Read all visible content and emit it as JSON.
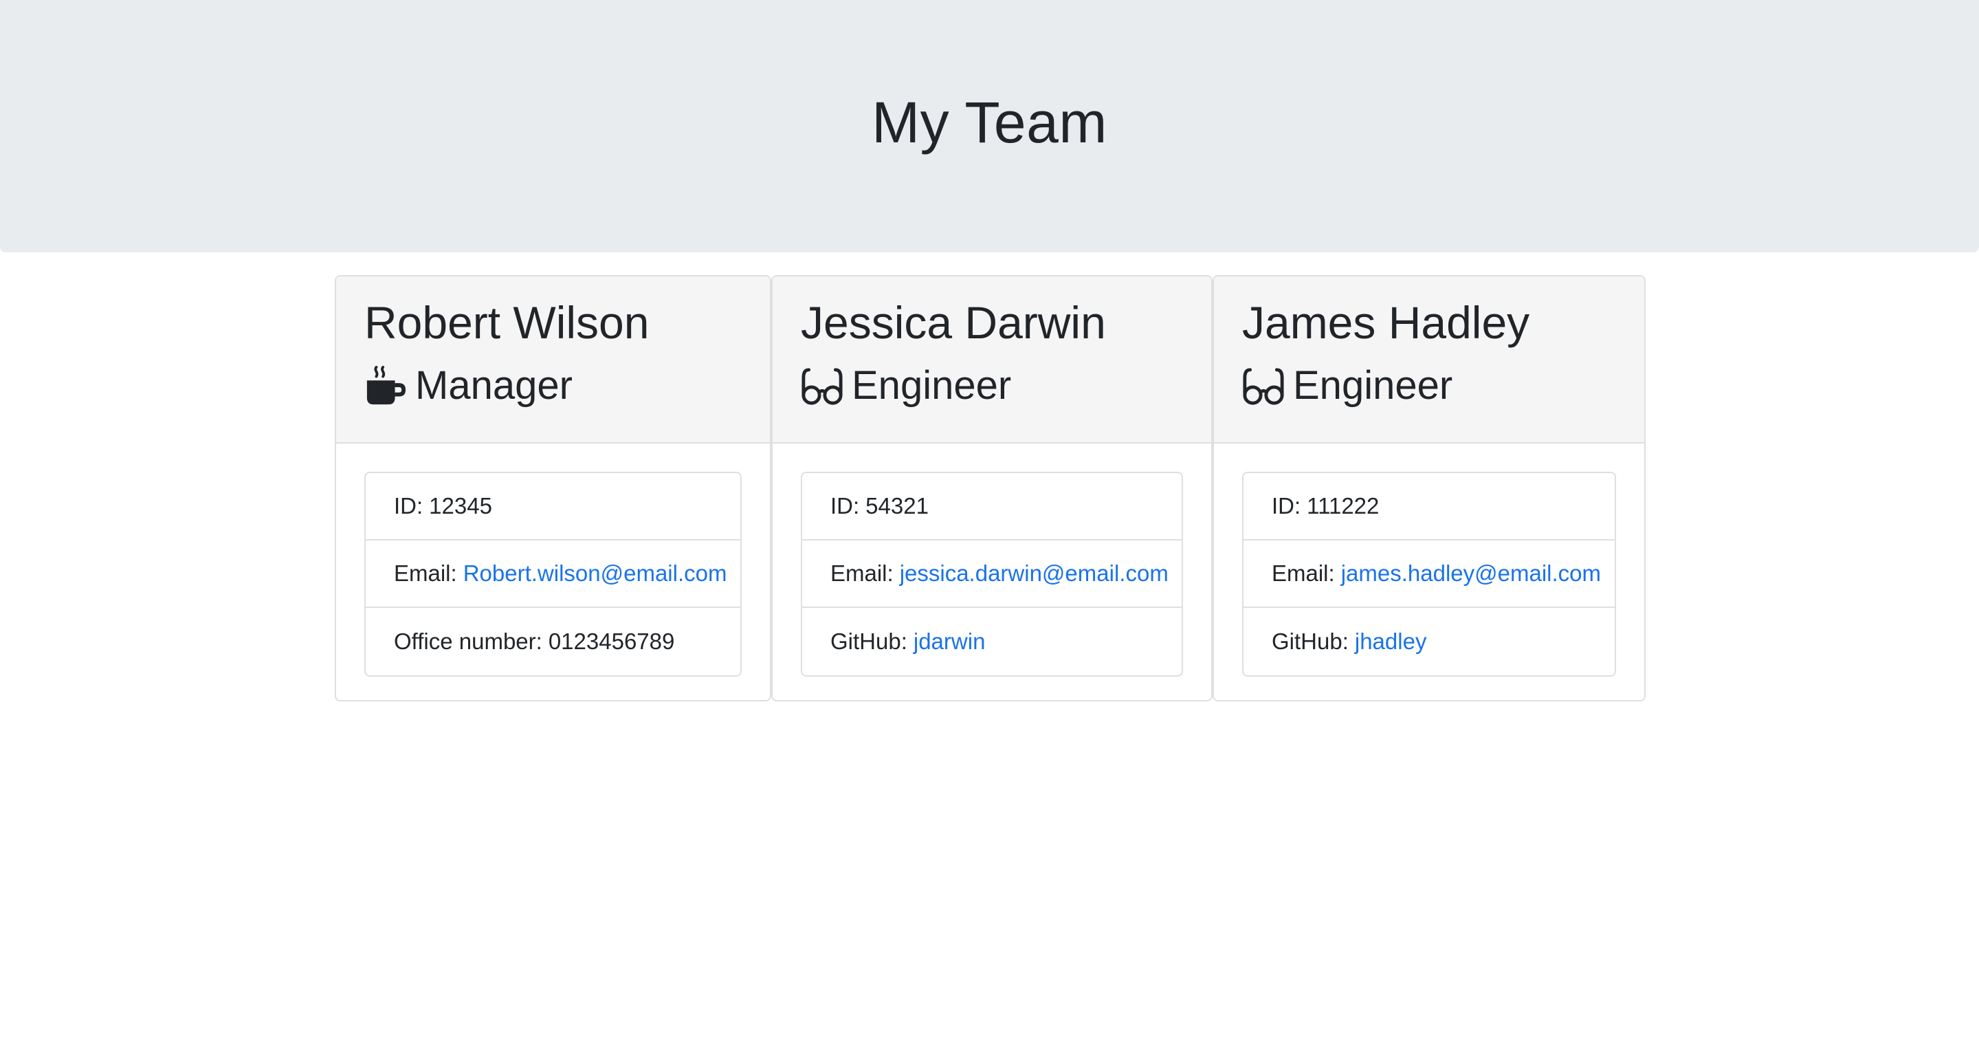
{
  "header": {
    "title": "My Team"
  },
  "employees": [
    {
      "name": "Robert Wilson",
      "role": "Manager",
      "role_icon": "coffee-mug-icon",
      "details": [
        {
          "label": "ID:",
          "value": "12345"
        },
        {
          "label": "Email:",
          "value": "Robert.wilson@email.com"
        },
        {
          "label": "Office number:",
          "value": "0123456789"
        }
      ]
    },
    {
      "name": "Jessica Darwin",
      "role": "Engineer",
      "role_icon": "glasses-icon",
      "details": [
        {
          "label": "ID:",
          "value": "54321"
        },
        {
          "label": "Email:",
          "value": "jessica.darwin@email.com"
        },
        {
          "label": "GitHub:",
          "value": "jdarwin"
        }
      ]
    },
    {
      "name": "James Hadley",
      "role": "Engineer",
      "role_icon": "glasses-icon",
      "details": [
        {
          "label": "ID:",
          "value": "111222"
        },
        {
          "label": "Email:",
          "value": "james.hadley@email.com"
        },
        {
          "label": "GitHub:",
          "value": "jhadley"
        }
      ]
    }
  ],
  "colors": {
    "jumbotron_bg": "#e9ecef",
    "card_header_bg": "#f5f5f5",
    "link": "#1a73e8",
    "text": "#212529",
    "border": "#dfdfdf"
  }
}
